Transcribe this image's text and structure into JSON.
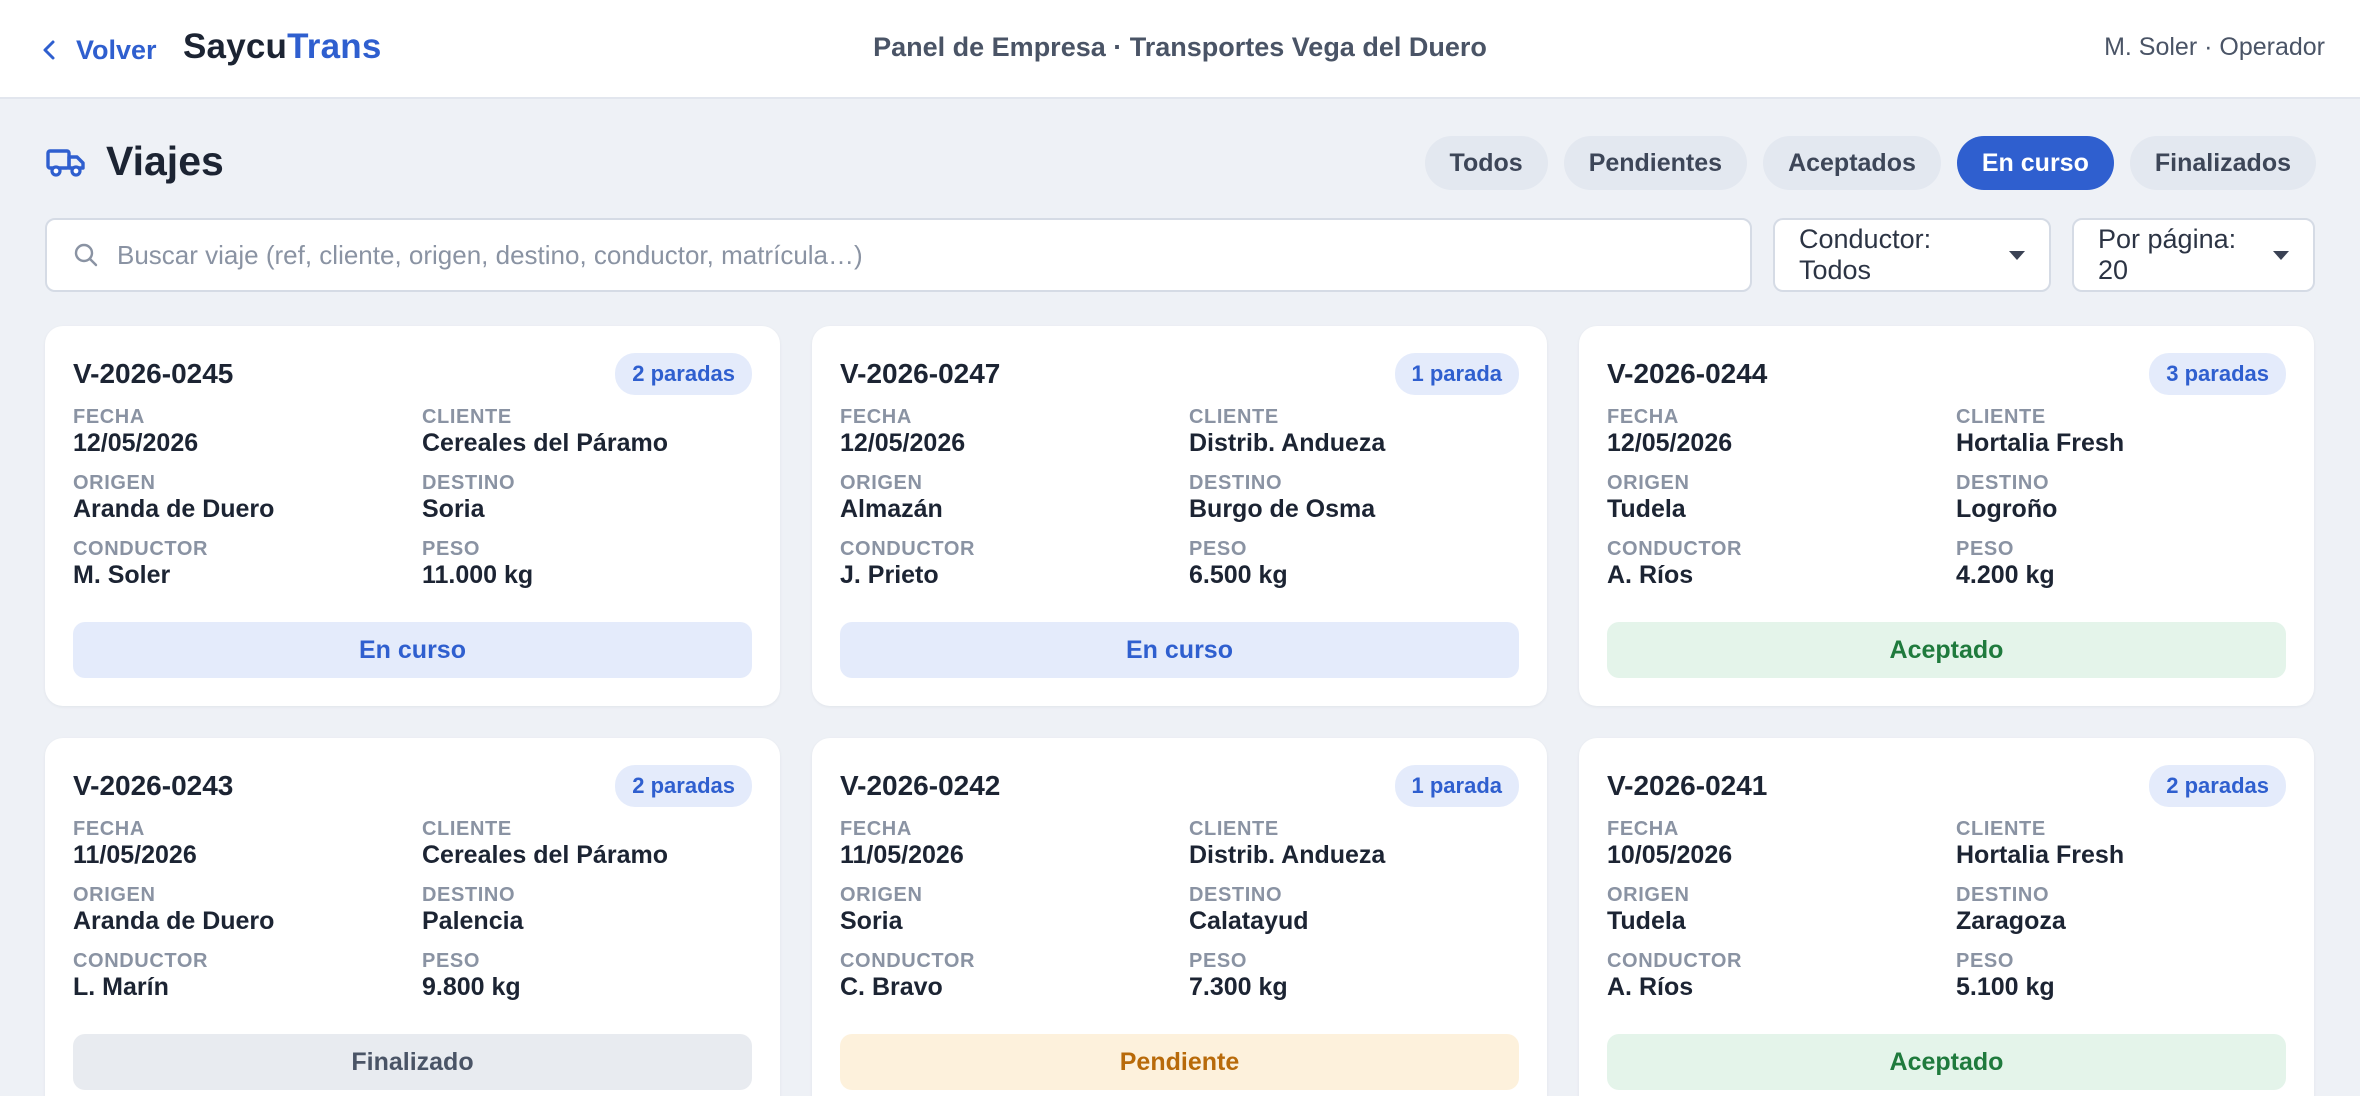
{
  "topbar": {
    "back_label": "Volver",
    "logo_part1": "Saycu",
    "logo_part2": "Trans",
    "center_title": "Panel de Empresa · Transportes Vega del Duero",
    "user_info": "M. Soler · Operador"
  },
  "page": {
    "title": "Viajes",
    "title_icon": "truck-icon"
  },
  "tabs": [
    {
      "label": "Todos",
      "active": false
    },
    {
      "label": "Pendientes",
      "active": false
    },
    {
      "label": "Aceptados",
      "active": false
    },
    {
      "label": "En curso",
      "active": true
    },
    {
      "label": "Finalizados",
      "active": false
    }
  ],
  "search": {
    "placeholder": "Buscar viaje (ref, cliente, origen, destino, conductor, matrícula…)",
    "value": ""
  },
  "filters": {
    "driver_label": "Conductor: Todos",
    "per_page_label": "Por página: 20"
  },
  "field_labels": {
    "fecha": "FECHA",
    "cliente": "CLIENTE",
    "origen": "ORIGEN",
    "destino": "DESTINO",
    "conductor": "CONDUCTOR",
    "peso": "PESO"
  },
  "colors": {
    "accent": "#2f5fcf",
    "status_en_curso": "#2f5fcf",
    "status_aceptado": "#1f7a3d",
    "status_finalizado": "#4a5466",
    "status_pendiente": "#b86a0a"
  },
  "trips": [
    {
      "ref": "V-2026-0245",
      "stops": "2 paradas",
      "fecha": "12/05/2026",
      "cliente": "Cereales del Páramo",
      "origen": "Aranda de Duero",
      "destino": "Soria",
      "conductor": "M. Soler",
      "peso": "11.000 kg",
      "status": "En curso",
      "status_key": "encurso"
    },
    {
      "ref": "V-2026-0247",
      "stops": "1 parada",
      "fecha": "12/05/2026",
      "cliente": "Distrib. Andueza",
      "origen": "Almazán",
      "destino": "Burgo de Osma",
      "conductor": "J. Prieto",
      "peso": "6.500 kg",
      "status": "En curso",
      "status_key": "encurso"
    },
    {
      "ref": "V-2026-0244",
      "stops": "3 paradas",
      "fecha": "12/05/2026",
      "cliente": "Hortalia Fresh",
      "origen": "Tudela",
      "destino": "Logroño",
      "conductor": "A. Ríos",
      "peso": "4.200 kg",
      "status": "Aceptado",
      "status_key": "aceptado"
    },
    {
      "ref": "V-2026-0243",
      "stops": "2 paradas",
      "fecha": "11/05/2026",
      "cliente": "Cereales del Páramo",
      "origen": "Aranda de Duero",
      "destino": "Palencia",
      "conductor": "L. Marín",
      "peso": "9.800 kg",
      "status": "Finalizado",
      "status_key": "finalizado"
    },
    {
      "ref": "V-2026-0242",
      "stops": "1 parada",
      "fecha": "11/05/2026",
      "cliente": "Distrib. Andueza",
      "origen": "Soria",
      "destino": "Calatayud",
      "conductor": "C. Bravo",
      "peso": "7.300 kg",
      "status": "Pendiente",
      "status_key": "pendiente"
    },
    {
      "ref": "V-2026-0241",
      "stops": "2 paradas",
      "fecha": "10/05/2026",
      "cliente": "Hortalia Fresh",
      "origen": "Tudela",
      "destino": "Zaragoza",
      "conductor": "A. Ríos",
      "peso": "5.100 kg",
      "status": "Aceptado",
      "status_key": "aceptado"
    }
  ]
}
